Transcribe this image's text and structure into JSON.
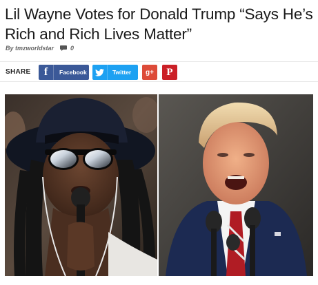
{
  "article": {
    "title": "Lil Wayne Votes for Donald Trump “Says He’s Rich and Rich Lives Matter”",
    "byline_prefix": "By",
    "author": "tmzworldstar",
    "comment_count": "0"
  },
  "share": {
    "label": "SHARE",
    "facebook": {
      "icon_text": "f",
      "label": "Facebook",
      "color": "#3b5998"
    },
    "twitter": {
      "label": "Twitter",
      "color": "#1da1f2"
    },
    "googleplus": {
      "icon_text": "g+",
      "color": "#dd4b39"
    },
    "pinterest": {
      "icon_text": "P",
      "color": "#cb2027"
    }
  },
  "icons": {
    "comment": "comment-icon",
    "facebook": "facebook-icon",
    "twitter": "twitter-bird-icon",
    "googleplus": "google-plus-icon",
    "pinterest": "pinterest-icon"
  }
}
